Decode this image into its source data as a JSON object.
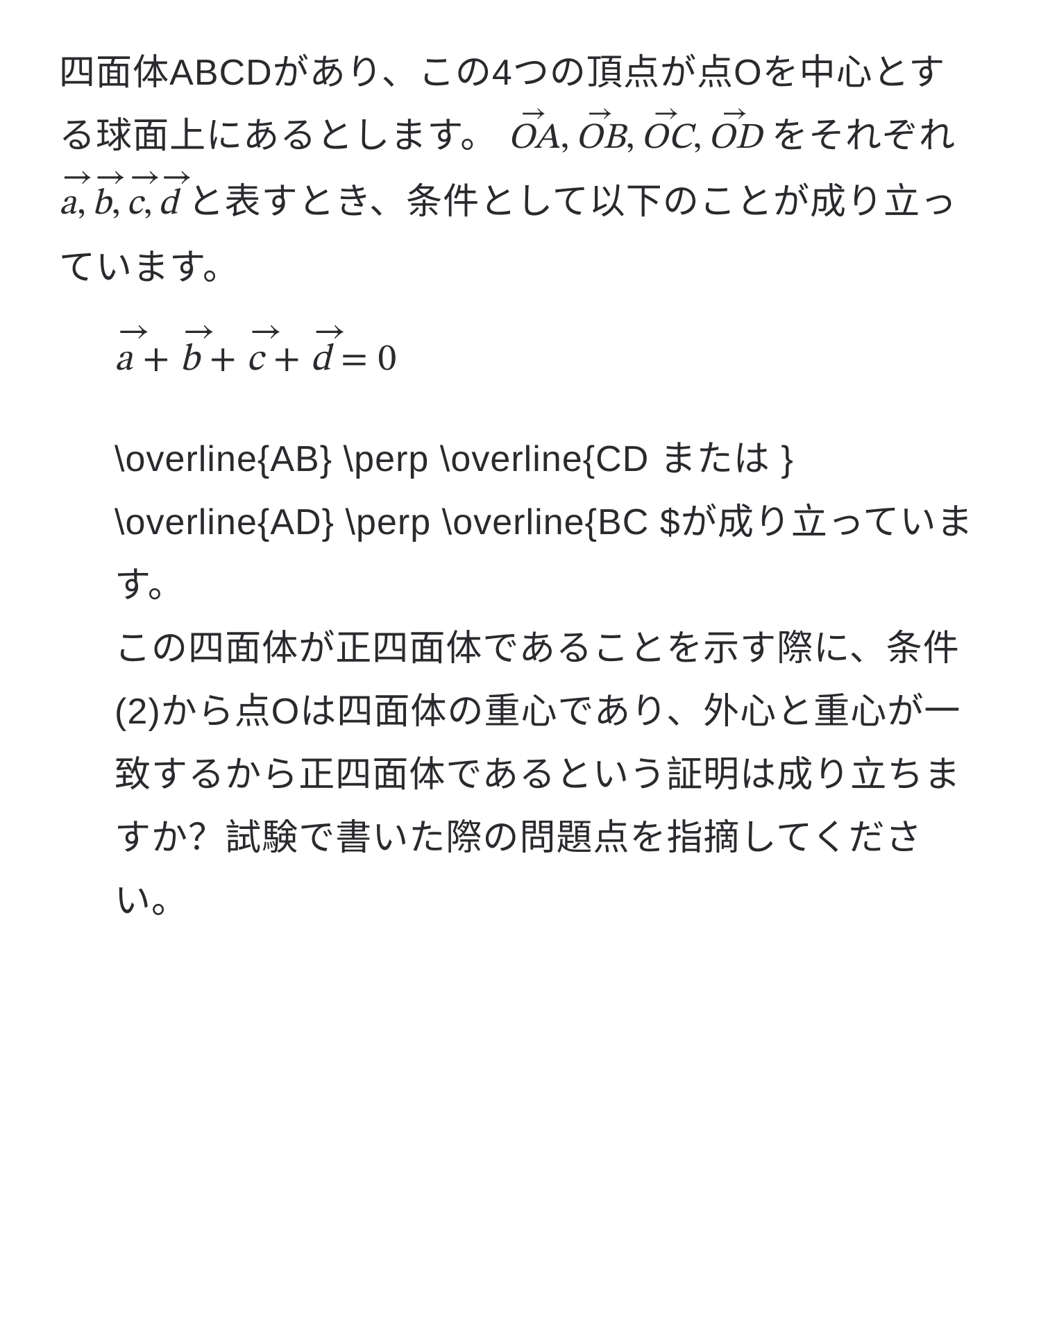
{
  "para1": {
    "t1": "四面体ABCDがあり、この4つの頂点が点Oを中心とする球面上にあるとします。",
    "vecOA_arrow": "→",
    "vecOA": "OA",
    "c1": ",",
    "vecOB_arrow": "→",
    "vecOB": "OB",
    "c2": ",",
    "vecOC_arrow": "→",
    "vecOC": "OC",
    "c3": ",",
    "vecOD_arrow": "→",
    "vecOD": "OD",
    "t2": " をそれぞれ ",
    "va_arrow": "→",
    "va": "a",
    "c4": ",",
    "vb_arrow": "→",
    "vb": "b",
    "c5": ",",
    "vc_arrow": "→",
    "vc": "c",
    "c6": ",",
    "vd_arrow": "→",
    "vd": "d",
    "t3": " と表すとき、条件として以下のことが成り立っています。"
  },
  "equation": {
    "va_arrow": "→",
    "va": "a",
    "plus1": "+",
    "vb_arrow": "→",
    "vb": "b",
    "plus2": "+",
    "vc_arrow": "→",
    "vc": "c",
    "plus3": "+",
    "vd_arrow": "→",
    "vd": "d",
    "eq": "=",
    "zero": "0"
  },
  "raw_latex": "\\overline{AB} \\perp \\overline{CD または } \\overline{AD} \\perp \\overline{BC $が成り立っています。",
  "para2": "この四面体が正四面体であることを示す際に、条件(2)から点Oは四面体の重心であり、外心と重心が一致するから正四面体であるという証明は成り立ちますか？試験で書いた際の問題点を指摘してください。"
}
